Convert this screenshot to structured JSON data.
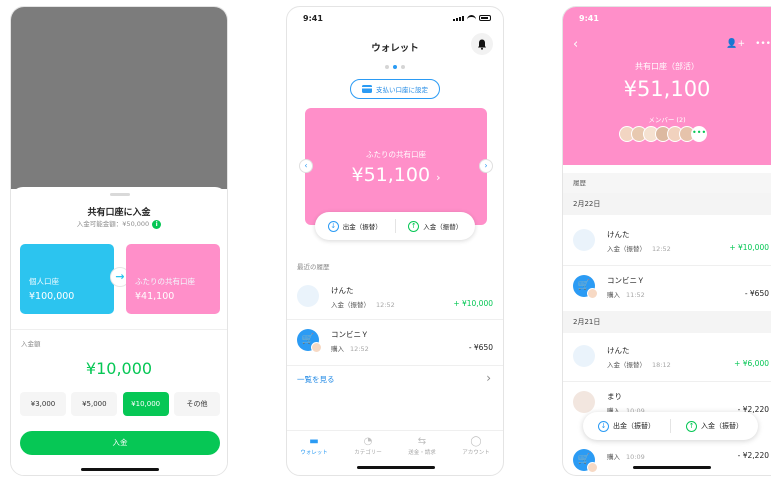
{
  "phone1": {
    "sheet_title": "共有口座に入金",
    "available": "入金可能金額：¥50,000",
    "info_icon": "i",
    "from_account": {
      "name": "個人口座",
      "amount": "¥100,000"
    },
    "to_account": {
      "name": "ふたりの共有口座",
      "amount": "¥41,100"
    },
    "arrow": "→",
    "amount_label": "入金額",
    "amount": "¥10,000",
    "chips": [
      "¥3,000",
      "¥5,000",
      "¥10,000",
      "その他"
    ],
    "selected_chip": "¥10,000",
    "deposit_button": "入金"
  },
  "phone2": {
    "time": "9:41",
    "title": "ウォレット",
    "pay_button": "支払い口座に設定",
    "card": {
      "name": "ふたりの共有口座",
      "amount": "¥51,100",
      "chevron": "›"
    },
    "withdraw": "出金（振替）",
    "deposit": "入金（振替）",
    "recent_label": "最近の履歴",
    "transactions": [
      {
        "name": "けんた",
        "type": "入金（振替）",
        "time": "12:52",
        "amount": "+ ¥10,000"
      },
      {
        "name": "コンビニＹ",
        "type": "購入",
        "time": "12:52",
        "amount": "- ¥650"
      }
    ],
    "see_all": "一覧を見る",
    "see_all_arrow": "›",
    "tabs": [
      {
        "label": "ウォレット",
        "icon": "▬"
      },
      {
        "label": "カテゴリー",
        "icon": "◔"
      },
      {
        "label": "送金・請求",
        "icon": "⇆"
      },
      {
        "label": "アカウント",
        "icon": "◯"
      }
    ]
  },
  "phone3": {
    "time": "9:41",
    "back": "‹",
    "add_member_icon": "👤+",
    "more_icon": "•••",
    "account_name": "共有口座（部活）",
    "amount": "¥51,100",
    "members_label": "メンバー (2)",
    "more_members": "•••",
    "history_label": "履歴",
    "sections": [
      {
        "date": "2月22日",
        "transactions": [
          {
            "name": "けんた",
            "type": "入金（振替）",
            "time": "12:52",
            "amount": "+ ¥10,000"
          },
          {
            "name": "コンビニＹ",
            "type": "購入",
            "time": "11:52",
            "amount": "- ¥650"
          }
        ]
      },
      {
        "date": "2月21日",
        "transactions": [
          {
            "name": "けんた",
            "type": "入金（振替）",
            "time": "18:12",
            "amount": "+ ¥6,000"
          },
          {
            "name": "まり",
            "type": "購入",
            "time": "10:09",
            "amount": "- ¥2,220"
          }
        ]
      }
    ],
    "last_row": {
      "type": "購入",
      "time": "10:09",
      "amount": "- ¥2,220"
    },
    "withdraw": "出金（振替）",
    "deposit": "入金（振替）"
  },
  "colors": {
    "green": "#06c755",
    "blue": "#2b9bf4",
    "pink": "#ff8fc9",
    "cyan": "#2cc4ef"
  }
}
